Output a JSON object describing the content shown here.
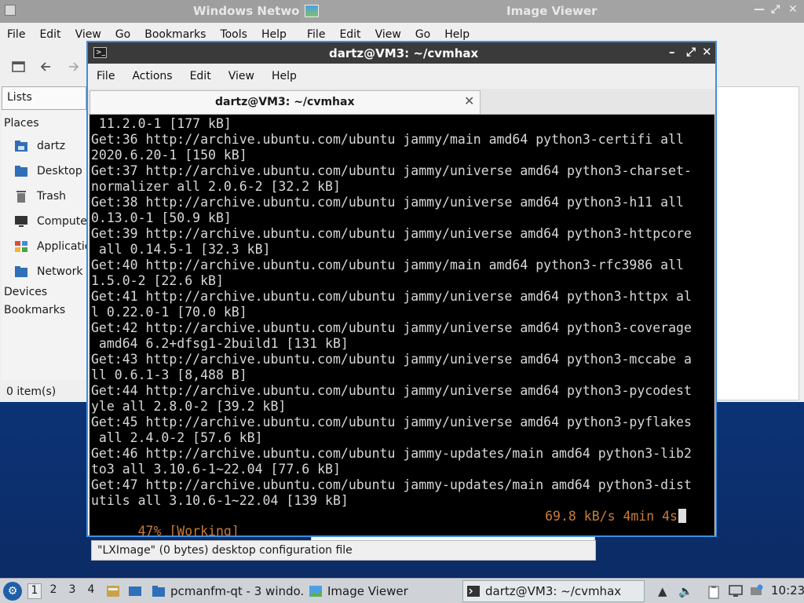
{
  "file_manager": {
    "title": "Windows Netwo",
    "menu": [
      "File",
      "Edit",
      "View",
      "Go",
      "Bookmarks",
      "Tools",
      "Help"
    ],
    "side_tab": "Lists",
    "places_header": "Places",
    "places": [
      "dartz",
      "Desktop",
      "Trash",
      "Computer",
      "Applications",
      "Network"
    ],
    "devices_header": "Devices",
    "bookmarks_header": "Bookmarks",
    "status": "0 item(s)",
    "info_status": "\"LXImage\" (0 bytes) desktop configuration file"
  },
  "image_viewer": {
    "title": "Image Viewer",
    "menu": [
      "File",
      "Edit",
      "View",
      "Go",
      "Help"
    ]
  },
  "terminal": {
    "title": "dartz@VM3: ~/cvmhax",
    "menu": [
      "File",
      "Actions",
      "Edit",
      "View",
      "Help"
    ],
    "tab_label": "dartz@VM3: ~/cvmhax",
    "lines": [
      " 11.2.0-1 [177 kB]",
      "Get:36 http://archive.ubuntu.com/ubuntu jammy/main amd64 python3-certifi all",
      "2020.6.20-1 [150 kB]",
      "Get:37 http://archive.ubuntu.com/ubuntu jammy/universe amd64 python3-charset-",
      "normalizer all 2.0.6-2 [32.2 kB]",
      "Get:38 http://archive.ubuntu.com/ubuntu jammy/universe amd64 python3-h11 all",
      "0.13.0-1 [50.9 kB]",
      "Get:39 http://archive.ubuntu.com/ubuntu jammy/universe amd64 python3-httpcore",
      " all 0.14.5-1 [32.3 kB]",
      "Get:40 http://archive.ubuntu.com/ubuntu jammy/main amd64 python3-rfc3986 all",
      "1.5.0-2 [22.6 kB]",
      "Get:41 http://archive.ubuntu.com/ubuntu jammy/universe amd64 python3-httpx al",
      "l 0.22.0-1 [70.0 kB]",
      "Get:42 http://archive.ubuntu.com/ubuntu jammy/universe amd64 python3-coverage",
      " amd64 6.2+dfsg1-2build1 [131 kB]",
      "Get:43 http://archive.ubuntu.com/ubuntu jammy/universe amd64 python3-mccabe a",
      "ll 0.6.1-3 [8,488 B]",
      "Get:44 http://archive.ubuntu.com/ubuntu jammy/universe amd64 python3-pycodest",
      "yle all 2.8.0-2 [39.2 kB]",
      "Get:45 http://archive.ubuntu.com/ubuntu jammy/universe amd64 python3-pyflakes",
      " all 2.4.0-2 [57.6 kB]",
      "Get:46 http://archive.ubuntu.com/ubuntu jammy-updates/main amd64 python3-lib2",
      "to3 all 3.10.6-1~22.04 [77.6 kB]",
      "Get:47 http://archive.ubuntu.com/ubuntu jammy-updates/main amd64 python3-dist",
      "utils all 3.10.6-1~22.04 [139 kB]"
    ],
    "progress_left": "47% [Working]",
    "progress_right": "69.8 kB/s 4min 4s",
    "progress_color": "#c97c3a"
  },
  "taskbar": {
    "desktops": [
      "1",
      "2",
      "3",
      "4"
    ],
    "tasks": [
      "pcmanfm-qt - 3 windo...",
      "Image Viewer",
      "dartz@VM3: ~/cvmhax"
    ],
    "clock": "10:23"
  },
  "icons": {
    "start": "start-menu-icon",
    "desktop": "desktop-background",
    "terminal": "terminal-icon",
    "folder": "folder-icon",
    "image": "image-icon"
  }
}
